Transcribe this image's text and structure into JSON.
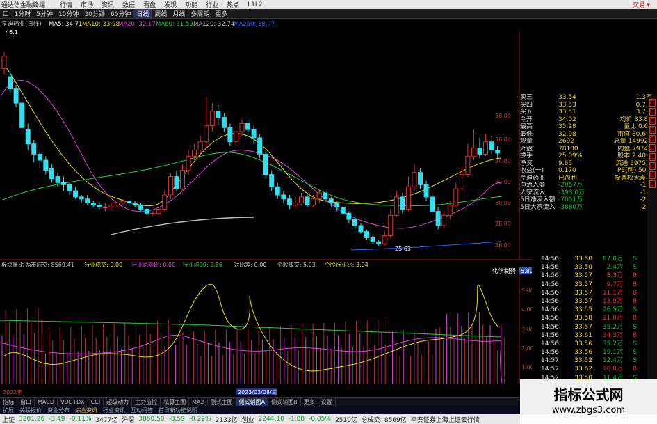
{
  "titlebar": {
    "app": "通达信金融终端",
    "menus": [
      "行情",
      "市场",
      "资讯",
      "数据",
      "看盘",
      "发现",
      "功能",
      "行业",
      "热点",
      "L1L2"
    ],
    "trade": "交易 ▾"
  },
  "periodbar": {
    "icon": "□",
    "items": [
      "1分时",
      "5分钟",
      "15分钟",
      "30分钟",
      "60分钟",
      "日线",
      "周线",
      "月线",
      "多周期",
      "更多"
    ],
    "selected": "日线"
  },
  "mainchart": {
    "stock_label": "亨迪药业(日线)",
    "ma": [
      {
        "label": "MA5: 34.71",
        "color": "#ffffff"
      },
      {
        "label": "MA10: 33.98",
        "color": "#e8e000"
      },
      {
        "label": "MA20: 32.17",
        "color": "#e040e0"
      },
      {
        "label": "MA60: 31.59",
        "color": "#20d040"
      },
      {
        "label": "MA120: 32.74",
        "color": "#c0c0c0"
      },
      {
        "label": "MA250: 38.07",
        "color": "#3060ff"
      }
    ],
    "high_label": "46.1",
    "low_label": "25.63",
    "y_ticks": [
      "38.00",
      "36.00",
      "34.00",
      "32.00",
      "30.00",
      "28.00",
      "26.00"
    ]
  },
  "subchart": {
    "header": [
      {
        "t": "板块量比",
        "c": "#c8c8c8"
      },
      {
        "t": "两市成交: 8569.41",
        "c": "#c8c8c8"
      },
      {
        "t": "行业成交: 0.00",
        "c": "#e8e000"
      },
      {
        "t": "行业总额比: 0.00",
        "c": "#e040e0"
      },
      {
        "t": "行业均99: 2.86",
        "c": "#20d040"
      },
      {
        "t": "对比差: 0.00",
        "c": "#c8c8c8"
      },
      {
        "t": "个股成交: 5.03",
        "c": "#c8c8c8"
      },
      {
        "t": "个股行业比: 3.04",
        "c": "#e8e000"
      }
    ],
    "sector": "化学制药",
    "value_box": "5.80",
    "y_ticks": [
      "5.00",
      "4.00",
      "3.00",
      "2.00",
      "1.00"
    ],
    "date_labels": [
      "2022年",
      "2023/03/08/三"
    ]
  },
  "quote": [
    [
      "卖三",
      "33.54",
      "1.3万"
    ],
    [
      "买四",
      "33.53",
      "0.7万"
    ],
    [
      "买五",
      "33.51",
      "3.7万"
    ],
    [
      "今开",
      "34.02",
      "均价 33.85"
    ],
    [
      "最高",
      "35.28",
      "量比 0.63"
    ],
    [
      "最低",
      "32.98",
      "市值 80.6亿"
    ],
    [
      "现量",
      "2692",
      "总量 149920"
    ],
    [
      "外盘",
      "78180",
      "内盘 79749"
    ],
    [
      "换手",
      "25.09%",
      "股本 2.40亿"
    ],
    [
      "净资",
      "9.65",
      "流通 5975万"
    ],
    [
      "收益(一)",
      "0.170",
      "PE(动) 50.5"
    ],
    [
      "亨迪药业",
      "已盈利",
      "投票权无差异"
    ],
    [
      "净流入额",
      "-2057万",
      "-1%"
    ],
    [
      "大宗流入",
      "-393.0万",
      "-1%"
    ],
    [
      "5日净流入额",
      "-7051万",
      "-2%"
    ],
    [
      "5日大宗流入",
      "-3880万",
      "-2%"
    ]
  ],
  "ticks": [
    [
      "14:56",
      "33.50",
      "67.0万",
      "S"
    ],
    [
      "14:56",
      "33.50",
      "2.4万",
      "S"
    ],
    [
      "14:56",
      "33.57",
      "8.3万",
      "B"
    ],
    [
      "14:56",
      "33.57",
      "9.7万",
      "B"
    ],
    [
      "14:56",
      "33.57",
      "11.1万",
      "B"
    ],
    [
      "14:56",
      "33.57",
      "13.9万",
      "B"
    ],
    [
      "14:56",
      "33.55",
      "26.5万",
      "S"
    ],
    [
      "14:56",
      "33.58",
      "21.0万",
      "B"
    ],
    [
      "14:56",
      "33.57",
      "35.2万",
      "S"
    ],
    [
      "14:56",
      "33.61",
      "34.3万",
      "B"
    ],
    [
      "14:56",
      "33.56",
      "35.2万",
      "S"
    ],
    [
      "14:56",
      "33.56",
      "19.1万",
      "S"
    ],
    [
      "14:57",
      "33.52",
      "12.4万",
      "S"
    ],
    [
      "14:57",
      "33.62",
      "10.8万",
      "B"
    ],
    [
      "14:57",
      "33.58",
      "11.4万",
      "S"
    ]
  ],
  "tabbar": [
    "指标",
    "窗口",
    "MACD",
    "VOL-TDX",
    "CCI",
    "超级动力",
    "主力监控",
    "私募主图",
    "MA2",
    "侧式主图",
    "侧式辅图A",
    "侧式辅图B",
    "更多",
    "设置"
  ],
  "tabbar_active": "侧式辅图A",
  "funcbar": [
    "扩展",
    "关联报价",
    "资金分布",
    "综合资讯",
    "行业资讯",
    "互动问答",
    "首日新功能说明"
  ],
  "funcbar_active": "综合资讯",
  "status": {
    "items": [
      {
        "t": "上证",
        "c": "neu"
      },
      {
        "t": "3201.26",
        "c": "dn"
      },
      {
        "t": "-3.49",
        "c": "dn"
      },
      {
        "t": "-0.11%",
        "c": "dn"
      },
      {
        "t": "3477亿",
        "c": "neu"
      },
      {
        "t": "沪深",
        "c": "neu"
      },
      {
        "t": "3850.50",
        "c": "dn"
      },
      {
        "t": "-8.59",
        "c": "dn"
      },
      {
        "t": "-0.22%",
        "c": "dn"
      },
      {
        "t": "2133亿",
        "c": "neu"
      },
      {
        "t": "创业",
        "c": "neu"
      },
      {
        "t": "2244.10",
        "c": "dn"
      },
      {
        "t": "-1.88",
        "c": "dn"
      },
      {
        "t": "-0.05%",
        "c": "dn"
      },
      {
        "t": "2510亿",
        "c": "neu"
      },
      {
        "t": "总成交",
        "c": "neu"
      },
      {
        "t": "8569亿",
        "c": "neu"
      },
      {
        "t": "平安证券上海上证云行情",
        "c": "neu"
      }
    ]
  },
  "watermark": {
    "title": "指标公式网",
    "url": "www.zbgs3.com"
  },
  "chart_data": {
    "type": "candlestick",
    "candles": [
      [
        43.0,
        44.2,
        42.4,
        44.6
      ],
      [
        42.2,
        41.0,
        40.6,
        43.0
      ],
      [
        41.0,
        39.6,
        39.2,
        41.4
      ],
      [
        39.6,
        37.2,
        36.8,
        40.2
      ],
      [
        37.0,
        35.6,
        35.0,
        37.6
      ],
      [
        35.6,
        34.6,
        33.8,
        36.0
      ],
      [
        34.6,
        34.0,
        33.2,
        35.0
      ],
      [
        34.0,
        33.0,
        32.6,
        34.4
      ],
      [
        33.2,
        32.2,
        31.8,
        33.6
      ],
      [
        32.4,
        31.8,
        31.4,
        32.8
      ],
      [
        31.8,
        31.6,
        31.0,
        32.4
      ],
      [
        31.6,
        31.0,
        30.6,
        31.8
      ],
      [
        31.0,
        30.4,
        30.2,
        31.4
      ],
      [
        30.4,
        30.2,
        29.8,
        30.6
      ],
      [
        30.2,
        29.8,
        29.6,
        30.6
      ],
      [
        29.8,
        29.6,
        29.4,
        30.0
      ],
      [
        29.6,
        29.4,
        29.2,
        29.8
      ],
      [
        29.4,
        29.4,
        29.0,
        29.8
      ],
      [
        29.4,
        29.6,
        29.2,
        29.8
      ],
      [
        29.6,
        29.8,
        29.4,
        30.0
      ],
      [
        29.8,
        30.0,
        29.6,
        30.2
      ],
      [
        30.0,
        29.8,
        29.6,
        30.2
      ],
      [
        29.8,
        29.6,
        29.4,
        30.0
      ],
      [
        29.6,
        29.2,
        29.0,
        29.8
      ],
      [
        29.2,
        28.8,
        28.6,
        29.4
      ],
      [
        28.8,
        28.8,
        28.6,
        29.0
      ],
      [
        28.8,
        29.2,
        28.6,
        29.4
      ],
      [
        29.2,
        30.6,
        29.0,
        31.0
      ],
      [
        30.6,
        32.4,
        30.2,
        32.8
      ],
      [
        32.4,
        31.2,
        31.0,
        33.0
      ],
      [
        31.2,
        33.0,
        31.0,
        33.6
      ],
      [
        33.0,
        34.4,
        32.6,
        35.0
      ],
      [
        34.4,
        35.0,
        34.0,
        35.6
      ],
      [
        35.0,
        35.8,
        34.6,
        36.4
      ],
      [
        35.8,
        37.4,
        35.2,
        40.2
      ],
      [
        37.4,
        38.8,
        36.8,
        39.6
      ],
      [
        38.8,
        38.2,
        37.4,
        39.4
      ],
      [
        38.2,
        37.2,
        36.8,
        38.6
      ],
      [
        37.2,
        35.8,
        35.4,
        37.6
      ],
      [
        35.8,
        36.8,
        35.4,
        37.4
      ],
      [
        36.8,
        37.6,
        36.4,
        38.0
      ],
      [
        37.6,
        37.0,
        36.4,
        38.0
      ],
      [
        37.0,
        36.2,
        35.6,
        37.4
      ],
      [
        36.2,
        34.6,
        34.2,
        36.6
      ],
      [
        34.6,
        32.6,
        32.2,
        35.0
      ],
      [
        32.6,
        31.4,
        31.0,
        33.0
      ],
      [
        31.4,
        30.6,
        30.2,
        31.8
      ],
      [
        30.6,
        30.2,
        29.8,
        31.0
      ],
      [
        30.2,
        29.6,
        29.2,
        30.6
      ],
      [
        29.6,
        29.8,
        29.4,
        30.4
      ],
      [
        29.8,
        30.4,
        29.6,
        30.8
      ],
      [
        30.4,
        29.6,
        29.4,
        30.8
      ],
      [
        29.6,
        30.2,
        29.4,
        30.6
      ],
      [
        30.2,
        30.8,
        29.8,
        31.2
      ],
      [
        30.8,
        30.2,
        29.8,
        31.0
      ],
      [
        30.2,
        29.8,
        29.4,
        30.4
      ],
      [
        29.8,
        29.4,
        29.0,
        30.0
      ],
      [
        29.4,
        28.8,
        28.6,
        29.6
      ],
      [
        28.8,
        28.2,
        27.8,
        29.0
      ],
      [
        28.2,
        27.6,
        27.2,
        28.6
      ],
      [
        27.6,
        27.0,
        26.8,
        27.8
      ],
      [
        27.0,
        26.4,
        26.2,
        27.2
      ],
      [
        26.4,
        26.0,
        25.8,
        26.6
      ],
      [
        26.0,
        25.8,
        25.6,
        26.2
      ],
      [
        25.8,
        26.6,
        25.6,
        27.0
      ],
      [
        26.6,
        28.6,
        26.4,
        29.2
      ],
      [
        28.6,
        30.4,
        28.4,
        31.0
      ],
      [
        30.4,
        29.2,
        28.8,
        30.8
      ],
      [
        29.2,
        31.4,
        29.0,
        32.4
      ],
      [
        31.4,
        32.8,
        31.0,
        33.6
      ],
      [
        32.8,
        31.6,
        31.2,
        33.2
      ],
      [
        31.6,
        30.4,
        30.0,
        32.0
      ],
      [
        30.4,
        29.0,
        28.6,
        30.8
      ],
      [
        29.0,
        27.6,
        27.2,
        29.4
      ],
      [
        27.6,
        28.6,
        27.4,
        29.0
      ],
      [
        28.6,
        29.6,
        28.2,
        30.0
      ],
      [
        29.6,
        31.2,
        29.4,
        31.8
      ],
      [
        31.2,
        32.6,
        31.0,
        33.4
      ],
      [
        32.6,
        34.4,
        32.4,
        35.6
      ],
      [
        34.4,
        35.2,
        34.0,
        37.0
      ],
      [
        35.2,
        34.6,
        34.2,
        36.2
      ],
      [
        34.6,
        35.8,
        34.4,
        36.6
      ],
      [
        35.8,
        35.0,
        34.6,
        36.4
      ],
      [
        35.0,
        34.7,
        34.2,
        35.4
      ]
    ]
  }
}
